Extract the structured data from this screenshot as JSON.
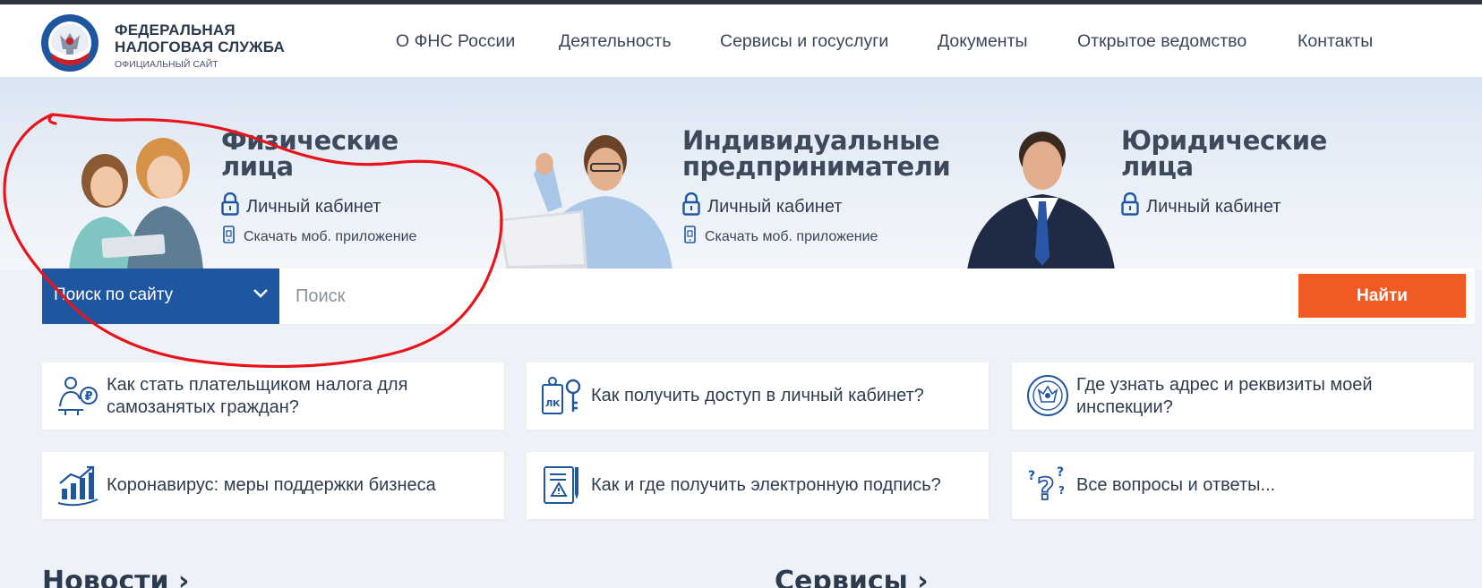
{
  "header": {
    "logo_line1": "ФЕДЕРАЛЬНАЯ",
    "logo_line2": "НАЛОГОВАЯ СЛУЖБА",
    "logo_sub": "ОФИЦИАЛЬНЫЙ САЙТ",
    "nav": [
      "О ФНС России",
      "Деятельность",
      "Сервисы и госуслуги",
      "Документы",
      "Открытое ведомство",
      "Контакты"
    ]
  },
  "categories": [
    {
      "title_line1": "Физические",
      "title_line2": "лица",
      "cabinet": "Личный кабинет",
      "app": "Скачать моб. приложение"
    },
    {
      "title_line1": "Индивидуальные",
      "title_line2": "предприниматели",
      "cabinet": "Личный кабинет",
      "app": "Скачать моб. приложение"
    },
    {
      "title_line1": "Юридические",
      "title_line2": "лица",
      "cabinet": "Личный кабинет"
    }
  ],
  "search": {
    "scope": "Поиск по сайту",
    "placeholder": "Поиск",
    "button": "Найти"
  },
  "cards": [
    {
      "icon": "self-employed-icon",
      "text": "Как стать плательщиком налога для самозанятых граждан?"
    },
    {
      "icon": "key-lk-icon",
      "text": "Как получить доступ в личный кабинет?"
    },
    {
      "icon": "emblem-icon",
      "text": "Где узнать адрес и реквизиты моей инспекции?"
    },
    {
      "icon": "growth-chart-icon",
      "text": "Коронавирус: меры поддержки бизнеса"
    },
    {
      "icon": "e-signature-icon",
      "text": "Как и где получить электронную подпись?"
    },
    {
      "icon": "questions-icon",
      "text": "Все вопросы и ответы..."
    }
  ],
  "sections": {
    "news": "Новости ›",
    "services": "Сервисы ›"
  },
  "colors": {
    "brand_blue": "#1f56a0",
    "accent_orange": "#f05a23",
    "annotation_red": "#e8141b"
  }
}
